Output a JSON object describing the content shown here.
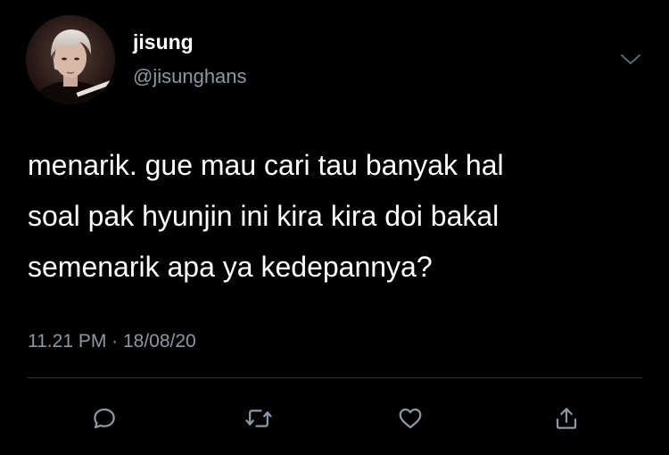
{
  "user": {
    "display_name": "jisung",
    "handle": "@jisunghans",
    "avatar_icon": "profile-photo"
  },
  "tweet": {
    "text": "menarik. gue mau cari tau banyak hal\nsoal pak hyunjin ini kira kira doi bakal\nsemenarik apa ya kedepannya?",
    "timestamp": "11.21 PM · 18/08/20"
  },
  "actions": {
    "reply_icon": "reply-icon",
    "retweet_icon": "retweet-icon",
    "like_icon": "like-icon",
    "share_icon": "share-icon",
    "menu_icon": "chevron-down-icon"
  },
  "colors": {
    "background": "#000000",
    "text": "#ffffff",
    "secondary": "#8b98a5",
    "divider": "#2f3336"
  }
}
